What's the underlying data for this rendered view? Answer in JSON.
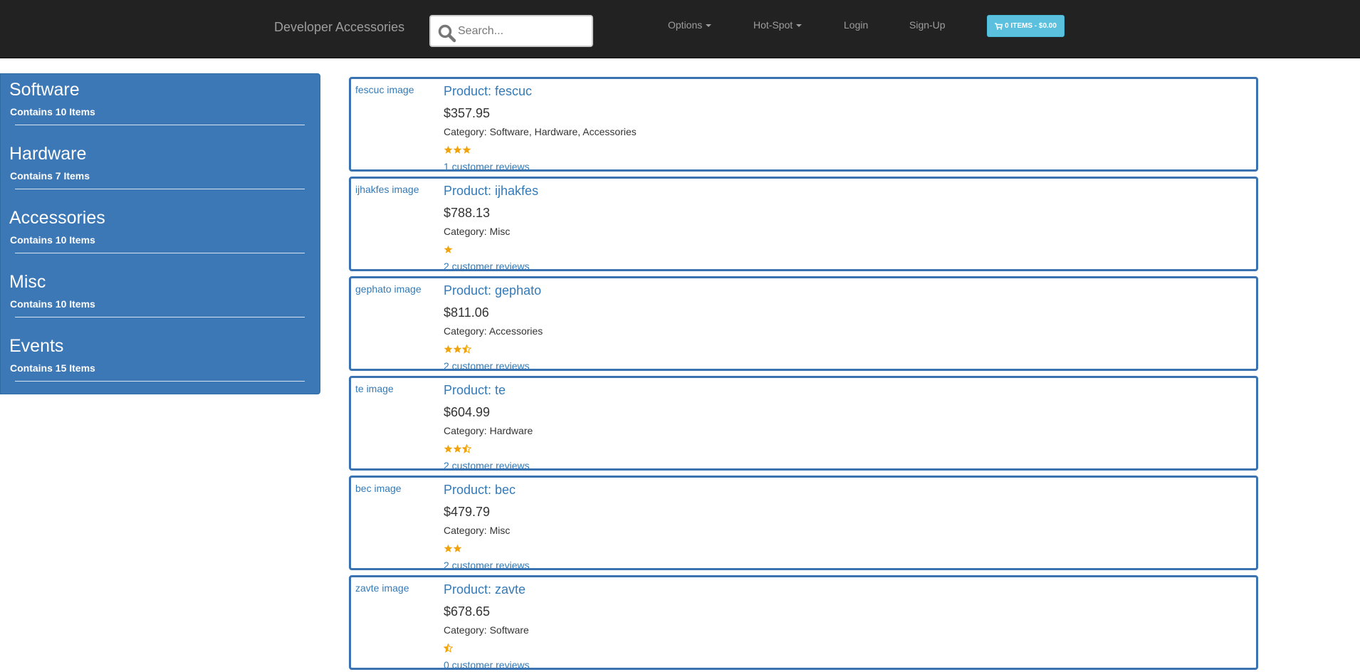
{
  "header": {
    "brand": "Developer Accessories",
    "search_placeholder": "Search...",
    "nav": [
      "Options",
      "Hot-Spot",
      "Login",
      "Sign-Up"
    ],
    "cart_label": "0 ITEMS - $0.00"
  },
  "sidebar": {
    "categories": [
      {
        "name": "Software",
        "count": "Contains 10 Items"
      },
      {
        "name": "Hardware",
        "count": "Contains 7 Items"
      },
      {
        "name": "Accessories",
        "count": "Contains 10 Items"
      },
      {
        "name": "Misc",
        "count": "Contains 10 Items"
      },
      {
        "name": "Events",
        "count": "Contains 15 Items"
      }
    ]
  },
  "products": [
    {
      "image_alt": "fescuc image",
      "title": "Product: fescuc",
      "price": "$357.95",
      "category": "Category: Software, Hardware, Accessories",
      "rating": 3,
      "reviews": "1 customer reviews"
    },
    {
      "image_alt": "ijhakfes image",
      "title": "Product: ijhakfes",
      "price": "$788.13",
      "category": "Category: Misc",
      "rating": 1,
      "reviews": "2 customer reviews"
    },
    {
      "image_alt": "gephato image",
      "title": "Product: gephato",
      "price": "$811.06",
      "category": "Category: Accessories",
      "rating": 2.5,
      "reviews": "2 customer reviews"
    },
    {
      "image_alt": "te image",
      "title": "Product: te",
      "price": "$604.99",
      "category": "Category: Hardware",
      "rating": 2.5,
      "reviews": "2 customer reviews"
    },
    {
      "image_alt": "bec image",
      "title": "Product: bec",
      "price": "$479.79",
      "category": "Category: Misc",
      "rating": 2,
      "reviews": "2 customer reviews"
    },
    {
      "image_alt": "zavte image",
      "title": "Product: zavte",
      "price": "$678.65",
      "category": "Category: Software",
      "rating": 0.5,
      "reviews": "0 customer reviews"
    }
  ],
  "colors": {
    "star": "#f0a30a",
    "accent": "#337ab7",
    "sidebar": "#3c77b6",
    "cart": "#5bc0de"
  }
}
